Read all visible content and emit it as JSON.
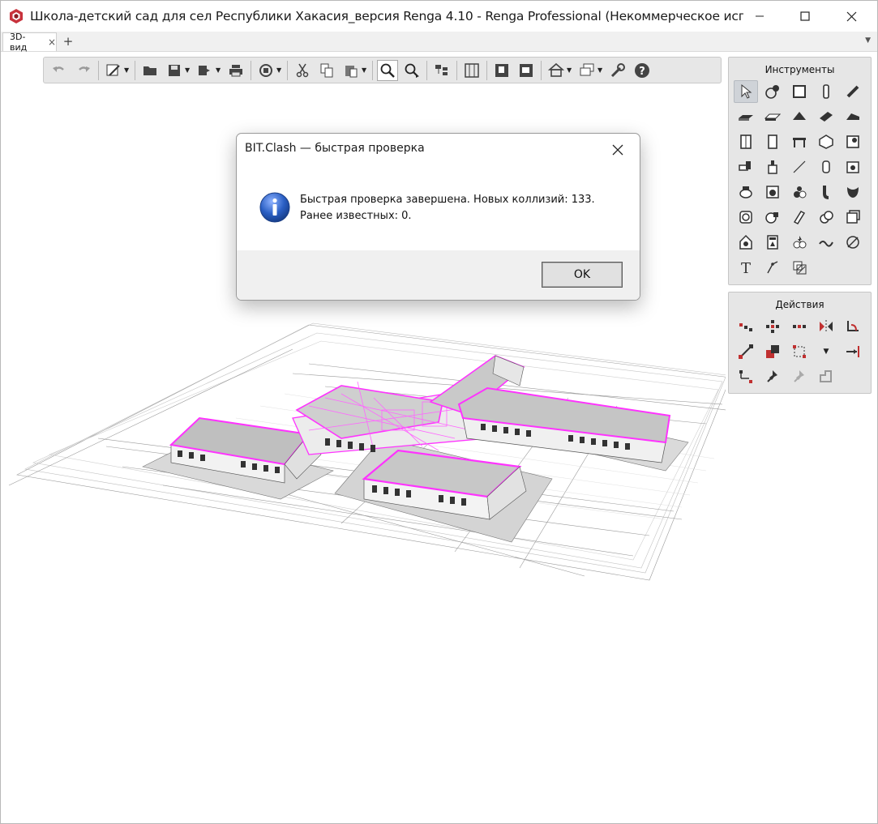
{
  "window": {
    "title": "Школа-детский сад для сел Республики Хакасия_версия Renga 4.10 - Renga Professional (Некоммерческое использование) -...",
    "minimize_icon": "minimize-icon",
    "maximize_icon": "maximize-icon",
    "close_icon": "close-icon"
  },
  "tabs": [
    {
      "label": "3D-вид",
      "close": "×"
    }
  ],
  "tab_add": "+",
  "toolbar": {
    "icons": [
      "undo-icon",
      "redo-icon",
      "select-filter-icon",
      "open-icon",
      "save-icon",
      "export-icon",
      "print-icon",
      "sync-icon",
      "cut-icon",
      "copy-icon",
      "paste-icon",
      "zoom-icon",
      "zoom-extents-icon",
      "properties-icon",
      "view-grid-icon",
      "views-icon",
      "levels-icon",
      "home-view-icon",
      "layers-icon",
      "settings-icon",
      "help-icon"
    ]
  },
  "instruments_panel": {
    "title": "Инструменты"
  },
  "actions_panel": {
    "title": "Действия"
  },
  "dialog": {
    "title": "BIT.Clash — быстрая проверка",
    "message": "Быстрая проверка завершена. Новых коллизий: 133. Ранее известных: 0.",
    "ok_label": "OK"
  },
  "colors": {
    "clash_highlight": "#ff33ff",
    "panel_bg": "#e6e6e6",
    "info_blue": "#2a5fc4"
  }
}
